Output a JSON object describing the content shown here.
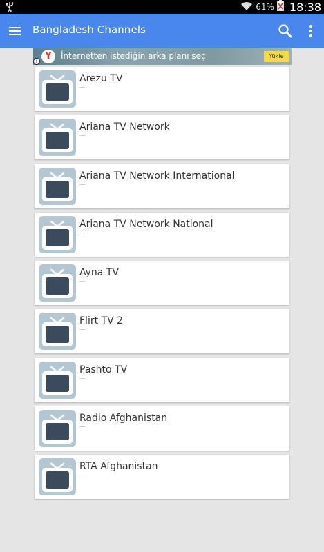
{
  "status_bar": {
    "battery_percent": "61%",
    "time": "18:38"
  },
  "app_bar": {
    "title": "Bangladesh Channels"
  },
  "ad": {
    "text": "İnternetten istediğin arka planı seç",
    "cta": "Yükle",
    "brand": "Yandex"
  },
  "channels": [
    {
      "name": "Arezu TV"
    },
    {
      "name": "Ariana TV Network"
    },
    {
      "name": "Ariana TV Network International"
    },
    {
      "name": "Ariana TV Network National"
    },
    {
      "name": "Ayna TV"
    },
    {
      "name": "Flirt TV 2"
    },
    {
      "name": "Pashto TV"
    },
    {
      "name": "Radio Afghanistan"
    },
    {
      "name": "RTA Afghanistan"
    }
  ],
  "icons": {
    "menu": "hamburger-menu-icon",
    "search": "search-icon",
    "overflow": "overflow-menu-icon",
    "thumbnail": "tv-icon"
  },
  "colors": {
    "app_bar": "#4a87ec",
    "background": "#e5e5e5",
    "card": "#ffffff"
  }
}
